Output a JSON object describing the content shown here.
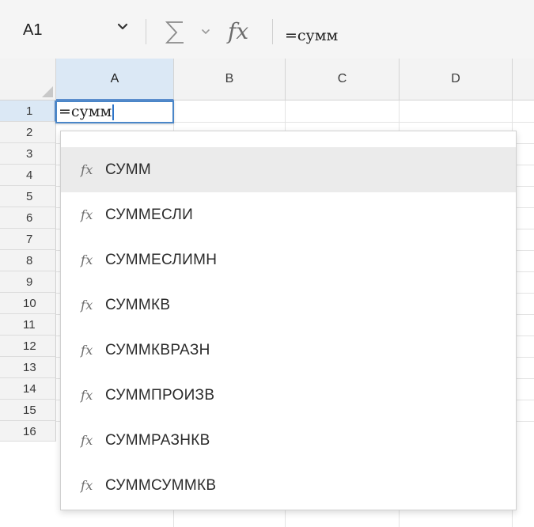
{
  "formula_bar": {
    "name_box": "A1",
    "sum_symbol": "∑",
    "fx_label": "fx",
    "formula": "=сумм"
  },
  "grid": {
    "columns": [
      "A",
      "B",
      "C",
      "D"
    ],
    "rows": [
      "1",
      "2",
      "3",
      "4",
      "5",
      "6",
      "7",
      "8",
      "9",
      "10",
      "11",
      "12",
      "13",
      "14",
      "15",
      "16"
    ],
    "active_cell_value": "=сумм"
  },
  "autocomplete": {
    "icon_glyph": "fx",
    "items": [
      "СУММ",
      "СУММЕСЛИ",
      "СУММЕСЛИМН",
      "СУММКВ",
      "СУММКВРАЗН",
      "СУММПРОИЗВ",
      "СУММРАЗНКВ",
      "СУММСУММКВ"
    ],
    "selected_index": 0
  },
  "colors": {
    "accent": "#4a86c8",
    "header_active_bg": "#dbe8f5",
    "selected_item_bg": "#ebebeb"
  }
}
